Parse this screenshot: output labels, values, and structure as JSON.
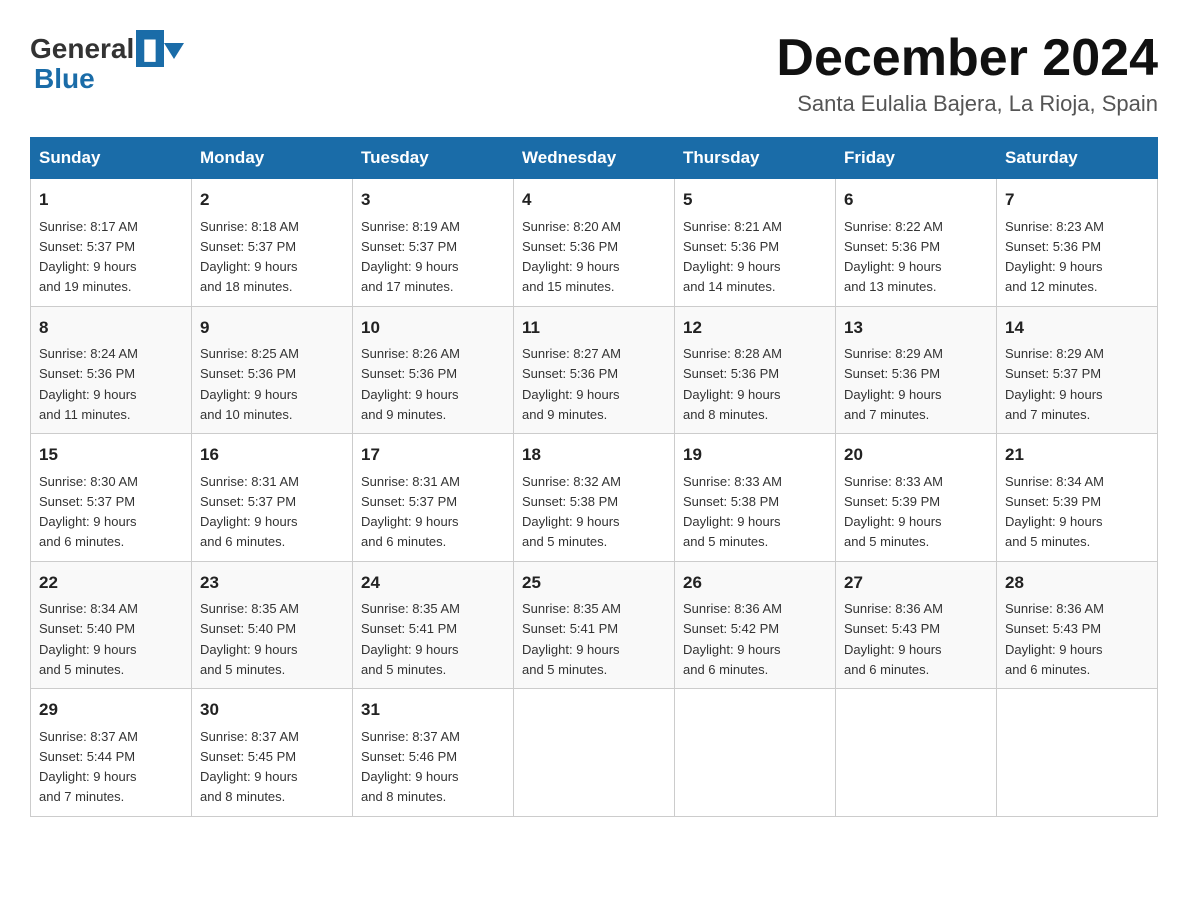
{
  "header": {
    "logo_general": "General",
    "logo_blue": "Blue",
    "month_title": "December 2024",
    "location": "Santa Eulalia Bajera, La Rioja, Spain"
  },
  "days_of_week": [
    "Sunday",
    "Monday",
    "Tuesday",
    "Wednesday",
    "Thursday",
    "Friday",
    "Saturday"
  ],
  "weeks": [
    [
      {
        "date": "1",
        "sunrise": "8:17 AM",
        "sunset": "5:37 PM",
        "daylight": "9 hours and 19 minutes."
      },
      {
        "date": "2",
        "sunrise": "8:18 AM",
        "sunset": "5:37 PM",
        "daylight": "9 hours and 18 minutes."
      },
      {
        "date": "3",
        "sunrise": "8:19 AM",
        "sunset": "5:37 PM",
        "daylight": "9 hours and 17 minutes."
      },
      {
        "date": "4",
        "sunrise": "8:20 AM",
        "sunset": "5:36 PM",
        "daylight": "9 hours and 15 minutes."
      },
      {
        "date": "5",
        "sunrise": "8:21 AM",
        "sunset": "5:36 PM",
        "daylight": "9 hours and 14 minutes."
      },
      {
        "date": "6",
        "sunrise": "8:22 AM",
        "sunset": "5:36 PM",
        "daylight": "9 hours and 13 minutes."
      },
      {
        "date": "7",
        "sunrise": "8:23 AM",
        "sunset": "5:36 PM",
        "daylight": "9 hours and 12 minutes."
      }
    ],
    [
      {
        "date": "8",
        "sunrise": "8:24 AM",
        "sunset": "5:36 PM",
        "daylight": "9 hours and 11 minutes."
      },
      {
        "date": "9",
        "sunrise": "8:25 AM",
        "sunset": "5:36 PM",
        "daylight": "9 hours and 10 minutes."
      },
      {
        "date": "10",
        "sunrise": "8:26 AM",
        "sunset": "5:36 PM",
        "daylight": "9 hours and 9 minutes."
      },
      {
        "date": "11",
        "sunrise": "8:27 AM",
        "sunset": "5:36 PM",
        "daylight": "9 hours and 9 minutes."
      },
      {
        "date": "12",
        "sunrise": "8:28 AM",
        "sunset": "5:36 PM",
        "daylight": "9 hours and 8 minutes."
      },
      {
        "date": "13",
        "sunrise": "8:29 AM",
        "sunset": "5:36 PM",
        "daylight": "9 hours and 7 minutes."
      },
      {
        "date": "14",
        "sunrise": "8:29 AM",
        "sunset": "5:37 PM",
        "daylight": "9 hours and 7 minutes."
      }
    ],
    [
      {
        "date": "15",
        "sunrise": "8:30 AM",
        "sunset": "5:37 PM",
        "daylight": "9 hours and 6 minutes."
      },
      {
        "date": "16",
        "sunrise": "8:31 AM",
        "sunset": "5:37 PM",
        "daylight": "9 hours and 6 minutes."
      },
      {
        "date": "17",
        "sunrise": "8:31 AM",
        "sunset": "5:37 PM",
        "daylight": "9 hours and 6 minutes."
      },
      {
        "date": "18",
        "sunrise": "8:32 AM",
        "sunset": "5:38 PM",
        "daylight": "9 hours and 5 minutes."
      },
      {
        "date": "19",
        "sunrise": "8:33 AM",
        "sunset": "5:38 PM",
        "daylight": "9 hours and 5 minutes."
      },
      {
        "date": "20",
        "sunrise": "8:33 AM",
        "sunset": "5:39 PM",
        "daylight": "9 hours and 5 minutes."
      },
      {
        "date": "21",
        "sunrise": "8:34 AM",
        "sunset": "5:39 PM",
        "daylight": "9 hours and 5 minutes."
      }
    ],
    [
      {
        "date": "22",
        "sunrise": "8:34 AM",
        "sunset": "5:40 PM",
        "daylight": "9 hours and 5 minutes."
      },
      {
        "date": "23",
        "sunrise": "8:35 AM",
        "sunset": "5:40 PM",
        "daylight": "9 hours and 5 minutes."
      },
      {
        "date": "24",
        "sunrise": "8:35 AM",
        "sunset": "5:41 PM",
        "daylight": "9 hours and 5 minutes."
      },
      {
        "date": "25",
        "sunrise": "8:35 AM",
        "sunset": "5:41 PM",
        "daylight": "9 hours and 5 minutes."
      },
      {
        "date": "26",
        "sunrise": "8:36 AM",
        "sunset": "5:42 PM",
        "daylight": "9 hours and 6 minutes."
      },
      {
        "date": "27",
        "sunrise": "8:36 AM",
        "sunset": "5:43 PM",
        "daylight": "9 hours and 6 minutes."
      },
      {
        "date": "28",
        "sunrise": "8:36 AM",
        "sunset": "5:43 PM",
        "daylight": "9 hours and 6 minutes."
      }
    ],
    [
      {
        "date": "29",
        "sunrise": "8:37 AM",
        "sunset": "5:44 PM",
        "daylight": "9 hours and 7 minutes."
      },
      {
        "date": "30",
        "sunrise": "8:37 AM",
        "sunset": "5:45 PM",
        "daylight": "9 hours and 8 minutes."
      },
      {
        "date": "31",
        "sunrise": "8:37 AM",
        "sunset": "5:46 PM",
        "daylight": "9 hours and 8 minutes."
      },
      null,
      null,
      null,
      null
    ]
  ],
  "sunrise_label": "Sunrise:",
  "sunset_label": "Sunset:",
  "daylight_label": "Daylight:"
}
